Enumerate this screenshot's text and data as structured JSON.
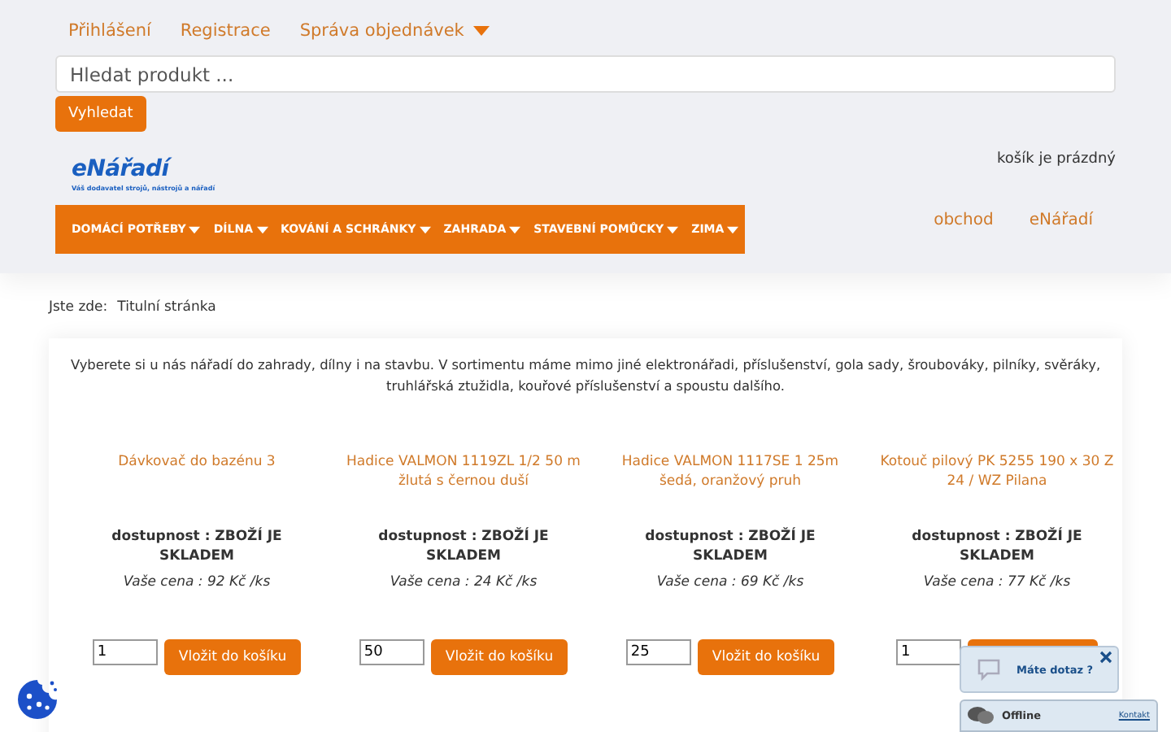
{
  "top_links": [
    {
      "label": "Přihlášení",
      "dropdown": false
    },
    {
      "label": "Registrace",
      "dropdown": false
    },
    {
      "label": "Správa objednávek",
      "dropdown": true
    }
  ],
  "search": {
    "placeholder": "Hledat produkt ...",
    "button": "Vyhledat"
  },
  "logo": {
    "text": "eNářadí",
    "tagline": "Váš dodavatel strojů, nástrojů a nářadí"
  },
  "cart": "košík je prázdný",
  "menu": [
    {
      "label": "DOMÁCÍ POTŘEBY"
    },
    {
      "label": "DÍLNA"
    },
    {
      "label": "KOVÁNÍ A SCHRÁNKY"
    },
    {
      "label": "ZAHRADA"
    },
    {
      "label": "STAVEBNÍ POMŮCKY"
    },
    {
      "label": "ZIMA"
    }
  ],
  "side_links": [
    "obchod",
    "eNářadí"
  ],
  "breadcrumb": {
    "label": "Jste zde:",
    "current": "Titulní stránka"
  },
  "intro": "Vyberete si u nás nářadí do zahrady, dílny i na stavbu. V sortimentu máme mimo jiné elektronářadi, příslušenství, gola sady, šroubováky, pilníky, svěráky, truhlářská ztužidla, kouřové příslušenství a spoustu dalšího.",
  "products": [
    {
      "name": "Dávkovač do bazénu 3",
      "availability": "dostupnost : ZBOŽÍ JE SKLADEM",
      "price": "Vaše cena : 92 Kč /ks",
      "quantity": "1",
      "button": "Vložit do košíku"
    },
    {
      "name": "Hadice VALMON 1119ZL 1/2 50 m žlutá s černou duší",
      "availability": "dostupnost : ZBOŽÍ JE SKLADEM",
      "price": "Vaše cena : 24 Kč /ks",
      "quantity": "50",
      "button": "Vložit do košíku"
    },
    {
      "name": "Hadice VALMON 1117SE 1 25m šedá, oranžový pruh",
      "availability": "dostupnost : ZBOŽÍ JE SKLADEM",
      "price": "Vaše cena : 69 Kč /ks",
      "quantity": "25",
      "button": "Vložit do košíku"
    },
    {
      "name": "Kotouč pilový PK 5255 190 x 30 Z 24 / WZ Pilana",
      "availability": "dostupnost : ZBOŽÍ JE SKLADEM",
      "price": "Vaše cena : 77 Kč /ks",
      "quantity": "1"
    }
  ],
  "chat": {
    "question": "Máte dotaz ?",
    "status": "Offline",
    "contact": "Kontakt"
  }
}
